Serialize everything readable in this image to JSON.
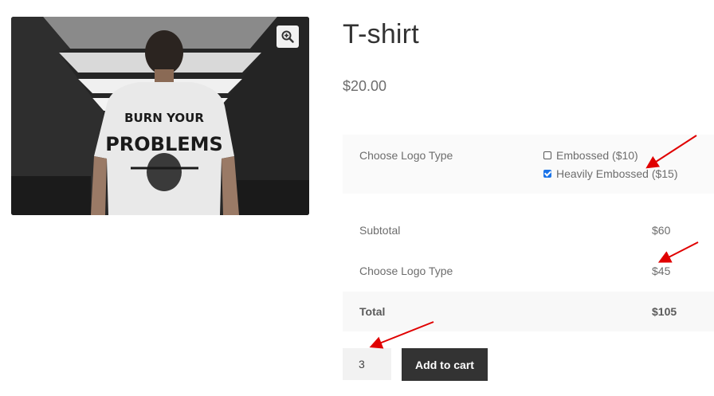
{
  "product": {
    "title": "T-shirt",
    "price": "$20.00",
    "image_shirt_text_line1": "BURN YOUR",
    "image_shirt_text_line2": "PROBLEMS"
  },
  "options": {
    "label": "Choose Logo Type",
    "items": [
      {
        "label": "Embossed ($10)",
        "checked": false
      },
      {
        "label": "Heavily Embossed ($15)",
        "checked": true
      }
    ]
  },
  "summary": {
    "rows": [
      {
        "label": "Subtotal",
        "value": "$60"
      },
      {
        "label": "Choose Logo Type",
        "value": "$45"
      },
      {
        "label": "Total",
        "value": "$105"
      }
    ]
  },
  "cart": {
    "quantity": "3",
    "add_to_cart_label": "Add to cart"
  },
  "icons": {
    "zoom": "zoom-in-icon"
  },
  "colors": {
    "annotation_arrow": "#e00000",
    "button_bg": "#333333",
    "checkbox_checked": "#1a73e8"
  }
}
